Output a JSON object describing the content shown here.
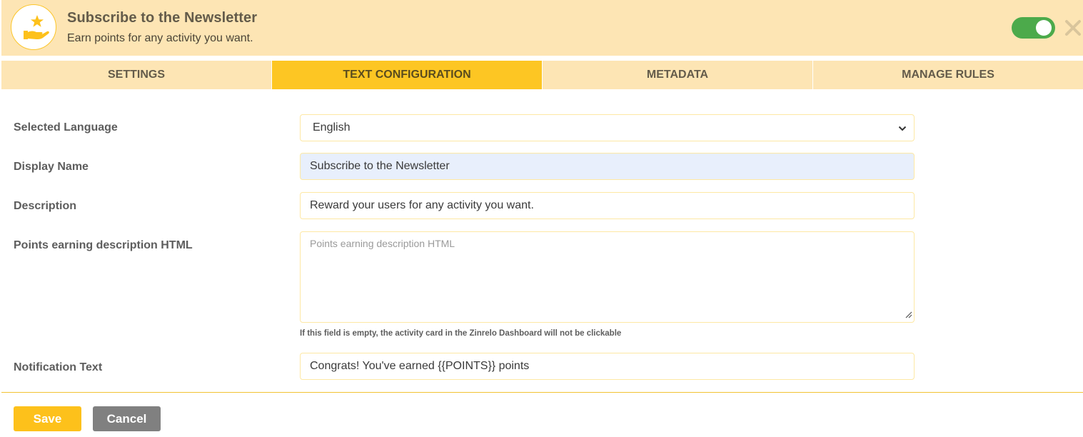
{
  "header": {
    "icon": "hand-star-icon",
    "title": "Subscribe to the Newsletter",
    "subtitle": "Earn points for any activity you want.",
    "toggle_enabled": true,
    "close_icon": "close-icon"
  },
  "tabs": [
    {
      "label": "Settings",
      "active": false
    },
    {
      "label": "Text Configuration",
      "active": true
    },
    {
      "label": "Metadata",
      "active": false
    },
    {
      "label": "Manage Rules",
      "active": false
    }
  ],
  "form": {
    "selected_language": {
      "label": "Selected Language",
      "value": "English",
      "icon": "chevron-down-icon"
    },
    "display_name": {
      "label": "Display Name",
      "value": "Subscribe to the Newsletter"
    },
    "description": {
      "label": "Description",
      "value": "Reward your users for any activity you want."
    },
    "points_earning_description": {
      "label": "Points earning description HTML",
      "value": "",
      "placeholder": "Points earning description HTML",
      "hint": "If this field is empty, the activity card in the Zinrelo Dashboard will not be clickable"
    },
    "notification_text": {
      "label": "Notification Text",
      "value": "Congrats! You've earned {{POINTS}} points"
    }
  },
  "actions": {
    "save_label": "Save",
    "cancel_label": "Cancel"
  },
  "colors": {
    "accent": "#fdc623",
    "header_bg": "#fde5b4",
    "toggle_on": "#4caa4b",
    "cancel_bg": "#808080"
  }
}
